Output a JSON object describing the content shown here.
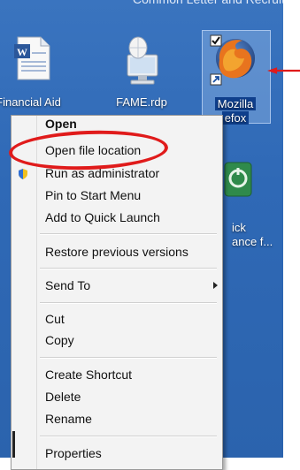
{
  "desktop": {
    "top_text": "Common Letter and Recruit",
    "icons": [
      {
        "label": "Financial Aid"
      },
      {
        "label": "FAME.rdp"
      },
      {
        "label_line1": "Mozilla",
        "label_line2": "Firefox",
        "visible_line2": "efox"
      },
      {
        "label_line1": "ick",
        "label_line2": "ance f..."
      }
    ]
  },
  "context_menu": {
    "items": [
      {
        "label": "Open",
        "bold": true
      },
      {
        "label": "Open file location"
      },
      {
        "label": "Run as administrator"
      },
      {
        "label": "Pin to Start Menu"
      },
      {
        "label": "Add to Quick Launch"
      },
      {
        "label": "Restore previous versions"
      },
      {
        "label": "Send To"
      },
      {
        "label": "Cut"
      },
      {
        "label": "Copy"
      },
      {
        "label": "Create Shortcut"
      },
      {
        "label": "Delete"
      },
      {
        "label": "Rename"
      },
      {
        "label": "Properties"
      }
    ]
  },
  "annotation": {
    "highlight_color": "#e01b1b",
    "arrow_color": "#e01b1b",
    "desktop_color": "#2f69b6"
  }
}
